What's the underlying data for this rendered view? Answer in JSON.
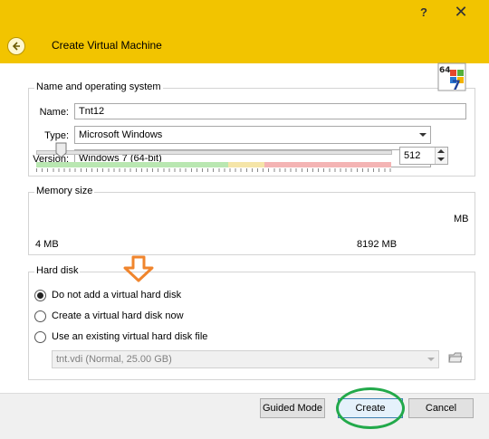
{
  "titlebar": {
    "help_icon": "?",
    "close_icon": "✕"
  },
  "header": {
    "title": "Create Virtual Machine",
    "back_icon": "back-arrow-icon"
  },
  "name_os": {
    "group_title": "Name and operating system",
    "name_label": "Name:",
    "name_value": "Tnt12",
    "type_label": "Type:",
    "type_value": "Microsoft Windows",
    "version_label": "Version:",
    "version_value": "Windows 7 (64-bit)",
    "os_icon_bits": "64",
    "os_icon_num": "7"
  },
  "memory": {
    "group_title": "Memory size",
    "value": "512",
    "unit": "MB",
    "min_label": "4 MB",
    "max_label": "8192 MB",
    "slider_fraction": 0.062
  },
  "hard_disk": {
    "group_title": "Hard disk",
    "options": [
      {
        "label": "Do not add a virtual hard disk",
        "checked": true
      },
      {
        "label": "Create a virtual hard disk now",
        "checked": false
      },
      {
        "label": "Use an existing virtual hard disk file",
        "checked": false
      }
    ],
    "existing_file": "tnt.vdi (Normal, 25.00 GB)"
  },
  "footer": {
    "guided_mode": "Guided Mode",
    "create": "Create",
    "cancel": "Cancel"
  },
  "colors": {
    "titlebar": "#f2c400",
    "zone_green": "#b9e7b1",
    "zone_yellow": "#f5e5a8",
    "zone_red": "#f4b4b4",
    "annotation_orange": "#f0852d",
    "annotation_green": "#22a94a"
  }
}
